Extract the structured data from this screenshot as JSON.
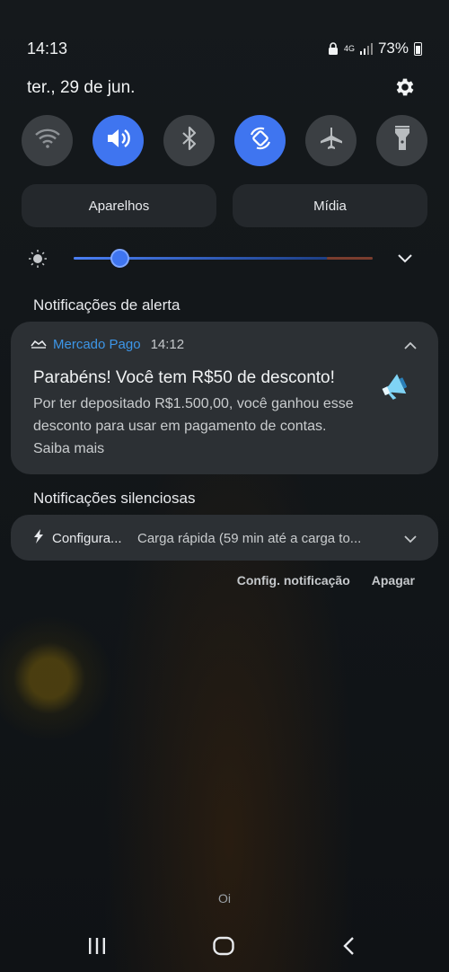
{
  "status_bar": {
    "time": "14:13",
    "network": "4G",
    "battery": "73%"
  },
  "header": {
    "date": "ter., 29 de jun."
  },
  "quick_settings": [
    {
      "name": "wifi",
      "active": false
    },
    {
      "name": "sound",
      "active": true
    },
    {
      "name": "bluetooth",
      "active": false
    },
    {
      "name": "auto-rotate",
      "active": true
    },
    {
      "name": "airplane-mode",
      "active": false
    },
    {
      "name": "flashlight",
      "active": false
    }
  ],
  "buttons": {
    "devices": "Aparelhos",
    "media": "Mídia"
  },
  "brightness": {
    "level": 0.16
  },
  "sections": {
    "alert": "Notificações de alerta",
    "silent": "Notificações silenciosas"
  },
  "alert_notification": {
    "app_name": "Mercado Pago",
    "time": "14:12",
    "title": "Parabéns! Você tem R$50 de desconto!",
    "body": "Por ter depositado R$1.500,00, você ganhou esse desconto para usar em pagamento de contas. Saiba mais"
  },
  "silent_notification": {
    "app_name": "Configura...",
    "text": "Carga rápida (59 min até a carga to..."
  },
  "actions": {
    "settings": "Config. notificação",
    "clear": "Apagar"
  },
  "background_text": "Oi",
  "colors": {
    "accent": "#3f75f0",
    "app_name": "#3d96e8",
    "card": "#2c3034"
  }
}
